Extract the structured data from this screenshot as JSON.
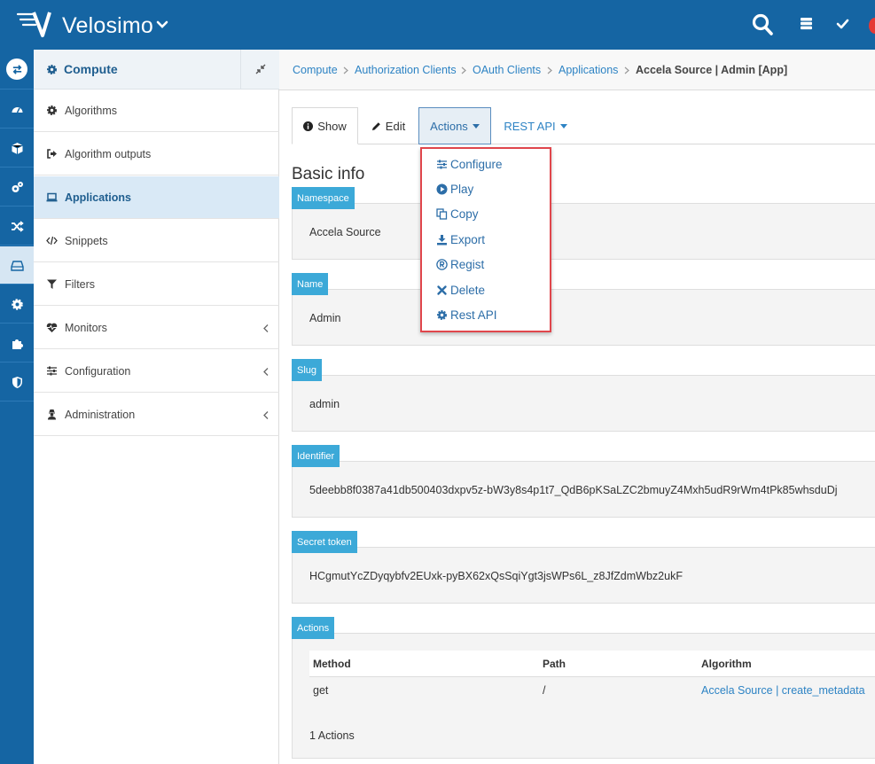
{
  "app": {
    "brand": "Velosimo"
  },
  "sidebar": {
    "header": "Compute",
    "items": [
      {
        "label": "Algorithms",
        "icon": "gear-icon"
      },
      {
        "label": "Algorithm outputs",
        "icon": "sign-out-icon"
      },
      {
        "label": "Applications",
        "icon": "laptop-icon",
        "active": true
      },
      {
        "label": "Snippets",
        "icon": "code-icon"
      },
      {
        "label": "Filters",
        "icon": "filter-icon"
      },
      {
        "label": "Monitors",
        "icon": "heartbeat-icon",
        "expandable": true
      },
      {
        "label": "Configuration",
        "icon": "sliders-icon",
        "expandable": true
      },
      {
        "label": "Administration",
        "icon": "user-secret-icon",
        "expandable": true
      }
    ]
  },
  "breadcrumb": {
    "items": [
      "Compute",
      "Authorization Clients",
      "OAuth Clients",
      "Applications"
    ],
    "current": "Accela Source | Admin [App]"
  },
  "tabs": {
    "show": "Show",
    "edit": "Edit",
    "actions": "Actions",
    "rest_api": "REST API"
  },
  "dropdown": {
    "items": [
      {
        "label": "Configure",
        "icon": "sliders-icon"
      },
      {
        "label": "Play",
        "icon": "play-circle-icon"
      },
      {
        "label": "Copy",
        "icon": "copy-icon"
      },
      {
        "label": "Export",
        "icon": "download-icon"
      },
      {
        "label": "Regist",
        "icon": "registered-icon"
      },
      {
        "label": "Delete",
        "icon": "times-icon"
      },
      {
        "label": "Rest API",
        "icon": "gear-icon"
      }
    ]
  },
  "content": {
    "section_title": "Basic info",
    "fields": [
      {
        "label": "Namespace",
        "value": "Accela Source"
      },
      {
        "label": "Name",
        "value": "Admin"
      },
      {
        "label": "Slug",
        "value": "admin"
      },
      {
        "label": "Identifier",
        "value": "5deebb8f0387a41db500403dxpv5z-bW3y8s4p1t7_QdB6pKSaLZC2bmuyZ4Mxh5udR9rWm4tPk85whsduDj"
      },
      {
        "label": "Secret token",
        "value": "HCgmutYcZDyqybfv2EUxk-pyBX62xQsSqiYgt3jsWPs6L_z8JfZdmWbz2ukF"
      }
    ],
    "actions": {
      "label": "Actions",
      "headers": [
        "Method",
        "Path",
        "Algorithm"
      ],
      "rows": [
        {
          "method": "get",
          "path": "/",
          "algorithm": "Accela Source | create_metadata"
        }
      ],
      "count": "1 Actions"
    }
  },
  "colors": {
    "primary": "#1565a3",
    "label_bg": "#3ca9d8",
    "link": "#2d83c4",
    "highlight_border": "#e0464c"
  }
}
